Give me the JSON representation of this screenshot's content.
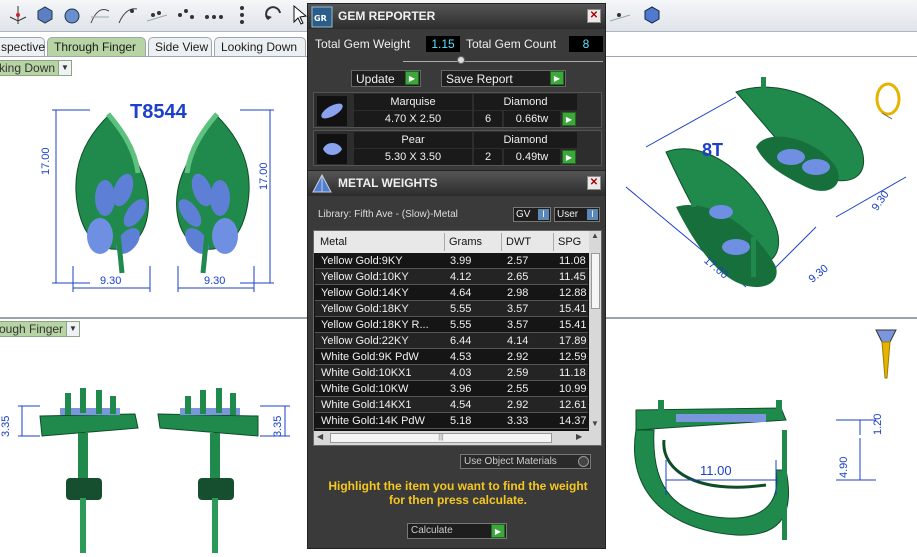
{
  "tabs": {
    "perspective": "spective",
    "through_finger": "Through Finger",
    "side_view": "Side View",
    "looking_down": "Looking Down"
  },
  "view_dropdowns": {
    "top_left": "king Down",
    "bottom_left": "ough Finger"
  },
  "viewport": {
    "model_label": "T8544",
    "model_label_iso": "8T",
    "dims": {
      "height_left": "17.00",
      "height_right": "17.00",
      "width_left": "9.30",
      "width_right": "9.30",
      "side_left": "3.35",
      "side_right": "3.35",
      "iso_a": "9.30",
      "iso_b": "17.00",
      "iso_c": "9.30",
      "lower_right_width": "11.00",
      "lower_right_top": "1.20",
      "lower_right_height": "4.90"
    }
  },
  "gem_reporter": {
    "title": "GEM REPORTER",
    "total_weight_label": "Total Gem Weight",
    "total_weight_value": "1.15",
    "total_count_label": "Total Gem Count",
    "total_count_value": "8",
    "update_label": "Update",
    "save_report_label": "Save Report",
    "gems": [
      {
        "shape": "Marquise",
        "type": "Diamond",
        "size": "4.70 X 2.50",
        "count": "6",
        "weight": "0.66tw"
      },
      {
        "shape": "Pear",
        "type": "Diamond",
        "size": "5.30 X 3.50",
        "count": "2",
        "weight": "0.49tw"
      }
    ]
  },
  "metal_weights": {
    "title": "METAL WEIGHTS",
    "library": "Library: Fifth Ave - (Slow)-Metal",
    "gv_label": "GV",
    "user_label": "User",
    "columns": [
      "Metal",
      "Grams",
      "DWT",
      "SPG"
    ],
    "rows": [
      [
        "Yellow Gold:9KY",
        "3.99",
        "2.57",
        "11.08"
      ],
      [
        "Yellow Gold:10KY",
        "4.12",
        "2.65",
        "11.45"
      ],
      [
        "Yellow Gold:14KY",
        "4.64",
        "2.98",
        "12.88"
      ],
      [
        "Yellow Gold:18KY",
        "5.55",
        "3.57",
        "15.41"
      ],
      [
        "Yellow Gold:18KY R...",
        "5.55",
        "3.57",
        "15.41"
      ],
      [
        "Yellow Gold:22KY",
        "6.44",
        "4.14",
        "17.89"
      ],
      [
        "White Gold:9K PdW",
        "4.53",
        "2.92",
        "12.59"
      ],
      [
        "White Gold:10KX1",
        "4.03",
        "2.59",
        "11.18"
      ],
      [
        "White Gold:10KW",
        "3.96",
        "2.55",
        "10.99"
      ],
      [
        "White Gold:14KX1",
        "4.54",
        "2.92",
        "12.61"
      ],
      [
        "White Gold:14K PdW",
        "5.18",
        "3.33",
        "14.37"
      ]
    ],
    "use_object_materials": "Use Object Materials",
    "hint": "Highlight the item you want to find the weight for then press calculate.",
    "calculate_label": "Calculate"
  },
  "colors": {
    "accent_green": "#3da63d",
    "tab_active": "#b7d4a4",
    "dimension_blue": "#1b40c9",
    "hint_yellow": "#f6c820",
    "model_green": "#1f8a4c"
  }
}
